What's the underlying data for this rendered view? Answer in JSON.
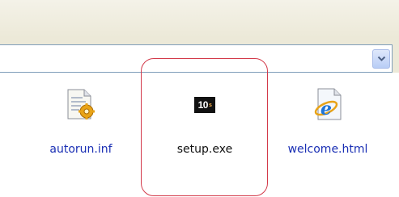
{
  "address_bar": {
    "value": ""
  },
  "files": [
    {
      "name": "autorun.inf",
      "icon": "settings-file-icon"
    },
    {
      "name": "setup.exe",
      "icon": "setup-exe-icon",
      "icon_text": "10",
      "icon_sup": "s",
      "highlighted": true
    },
    {
      "name": "welcome.html",
      "icon": "ie-document-icon"
    }
  ],
  "colors": {
    "toolbar": "#ece9d8",
    "highlight_ring": "#d33a4a",
    "link_label": "#1a2fb4",
    "address_border": "#7f9db9"
  }
}
